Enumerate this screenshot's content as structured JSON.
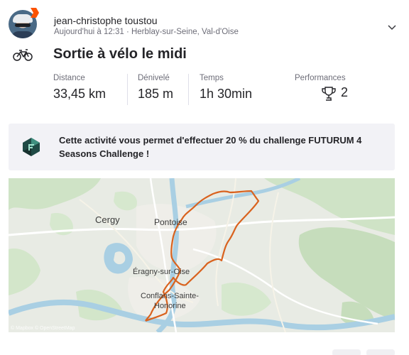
{
  "header": {
    "athlete_name": "jean-christophe toustou",
    "meta": "Aujourd'hui à 12:31 · Herblay-sur-Seine, Val-d'Oise",
    "avatar_icon": "athlete-avatar",
    "expand_icon": "chevron-down-icon"
  },
  "activity": {
    "sport_icon": "bike-icon",
    "title": "Sortie à vélo le midi"
  },
  "stats": [
    {
      "label": "Distance",
      "value": "33,45 km"
    },
    {
      "label": "Dénivelé",
      "value": "185 m"
    },
    {
      "label": "Temps",
      "value": "1h 30min"
    }
  ],
  "performances": {
    "label": "Performances",
    "icon": "trophy-icon",
    "count": "2"
  },
  "challenge": {
    "icon": "challenge-logo-icon",
    "text": "Cette activité vous permet d'effectuer 20 % du challenge FUTURUM 4 Seasons Challenge !"
  },
  "map": {
    "places": [
      "Cergy",
      "Pontoise",
      "Éragny-sur-Oise",
      "Conflans-Sainte-",
      "Honorine"
    ],
    "attribution": "© Mapbox © OpenStreetMap",
    "route_color": "#d9621e"
  },
  "colors": {
    "text": "#242428",
    "muted": "#6d6d78",
    "route": "#d9621e",
    "card_bg": "#f2f2f6"
  }
}
